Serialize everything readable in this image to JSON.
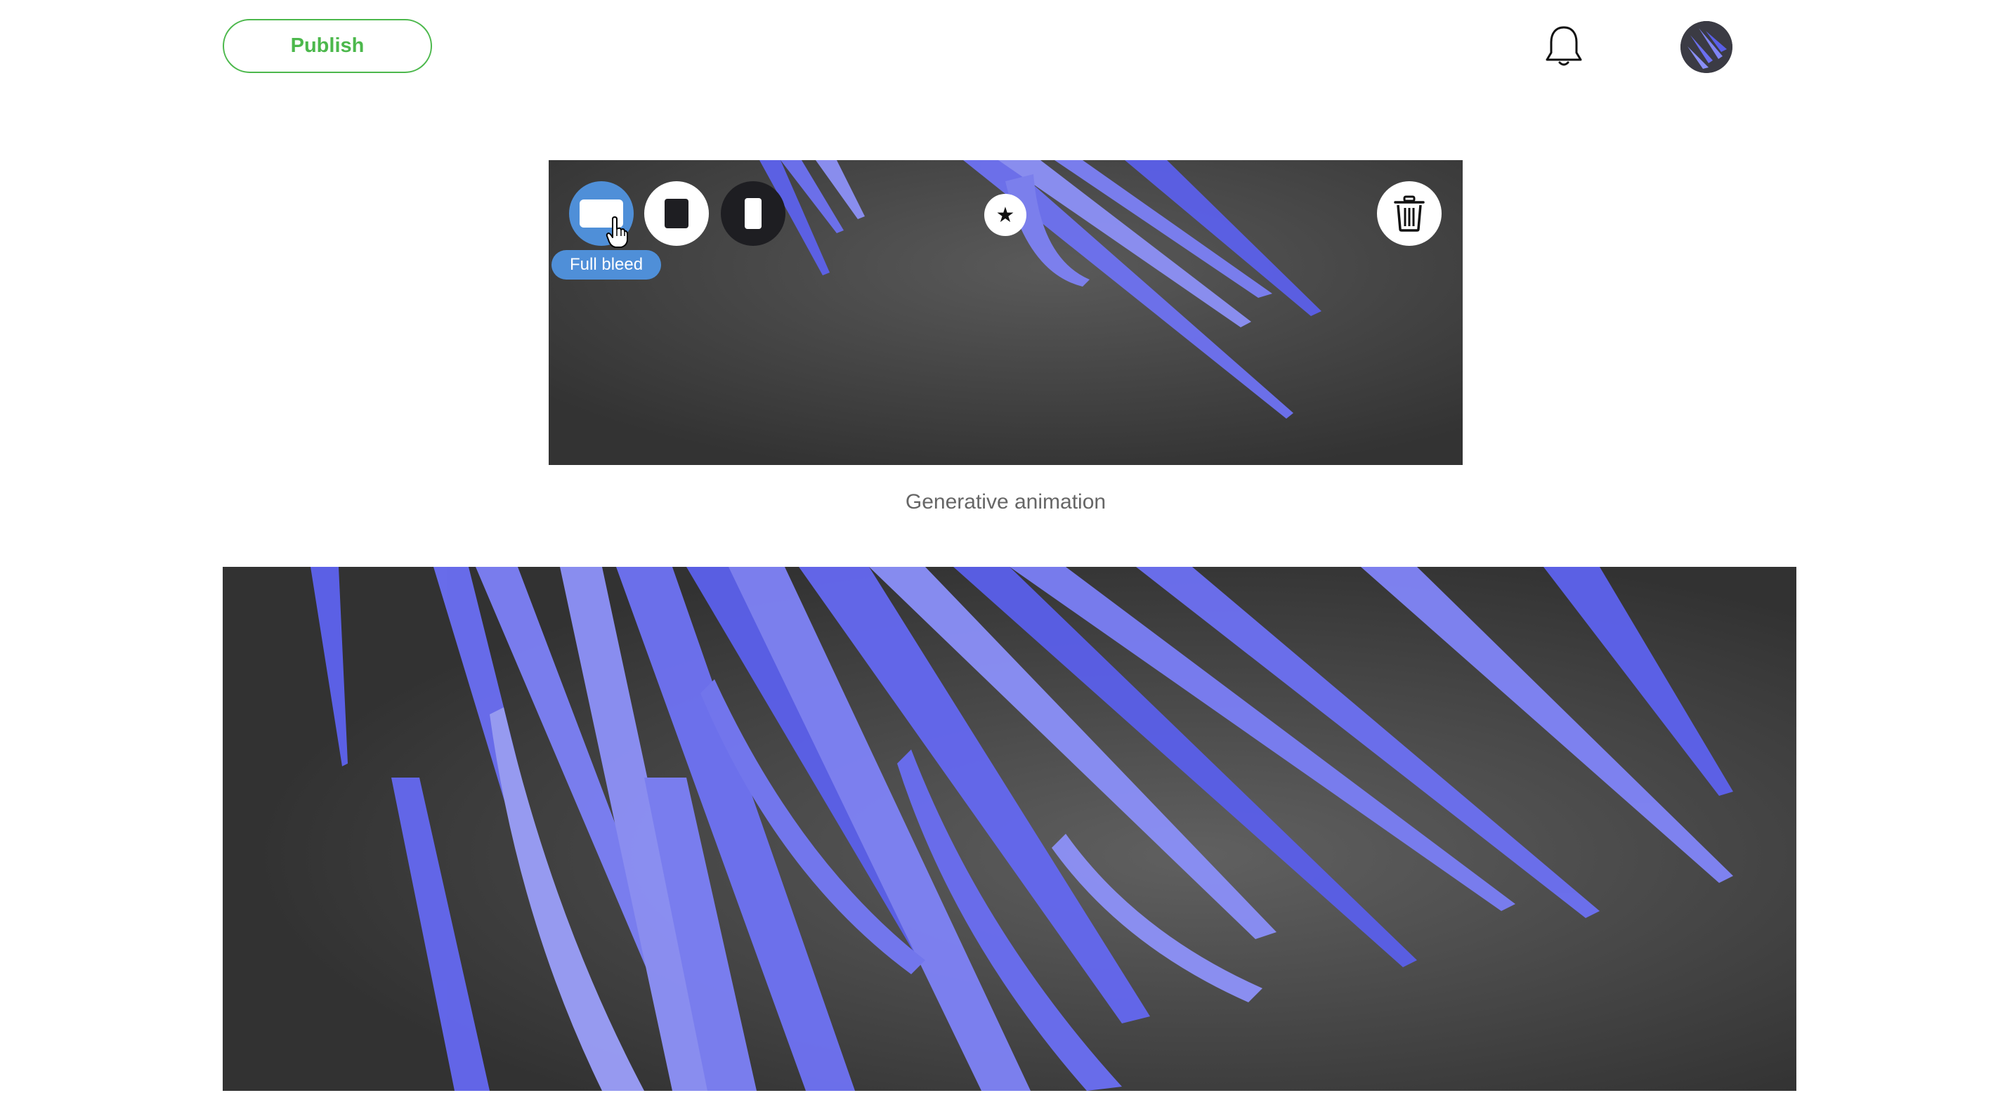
{
  "header": {
    "publish_label": "Publish",
    "notifications_icon": "bell-icon",
    "avatar_icon": "user-avatar"
  },
  "media_block": {
    "image_layout_options": [
      {
        "name": "full-bleed",
        "icon": "landscape-rect-icon",
        "selected": true
      },
      {
        "name": "square",
        "icon": "square-icon",
        "selected": false
      },
      {
        "name": "portrait",
        "icon": "portrait-rect-icon",
        "selected": false
      }
    ],
    "tooltip": "Full bleed",
    "star_glyph": "★",
    "delete_icon": "trash-icon",
    "caption": "Generative animation"
  },
  "colors": {
    "accent_green": "#4cb84c",
    "selected_blue": "#4f8fd8",
    "canvas_dark": "#3a3a3a",
    "shard_blue": "#6b6ff0"
  }
}
